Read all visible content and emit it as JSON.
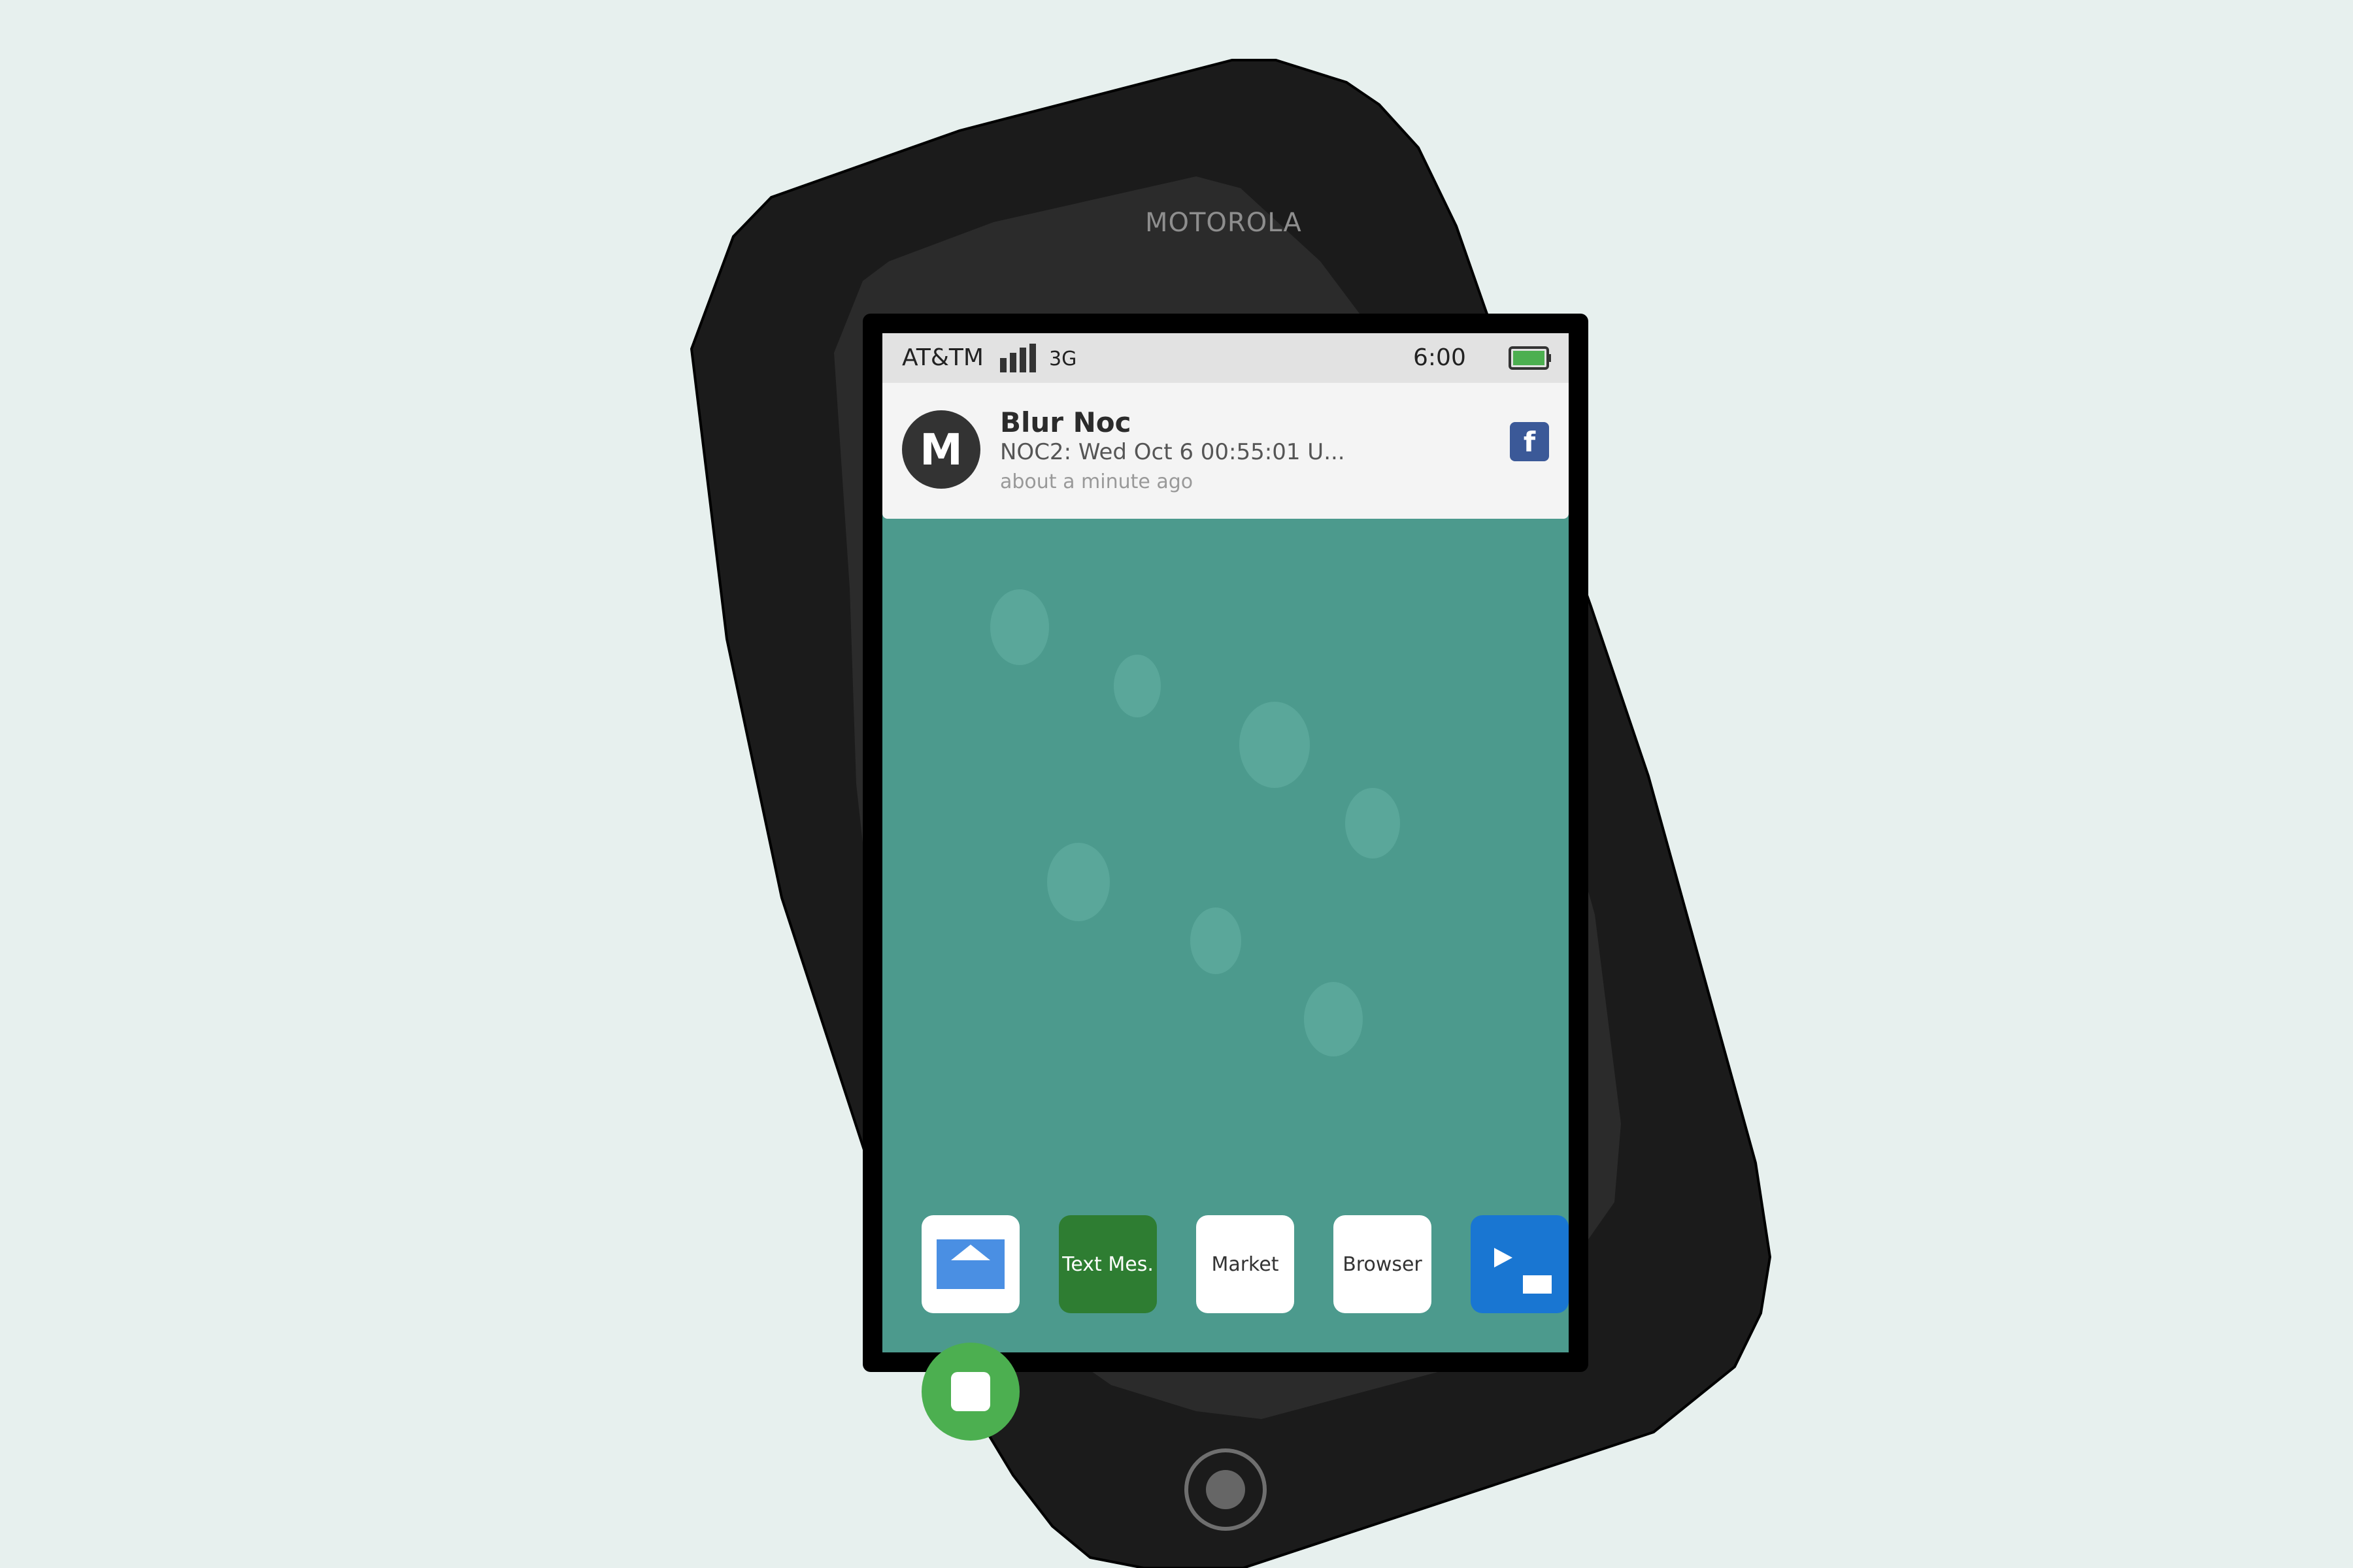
{
  "device": {
    "brand": "MOTOROLA"
  },
  "status_bar": {
    "carrier": "AT&TM",
    "network": "3G",
    "time": "6:00",
    "signal_bars": 4,
    "battery_level": 1.0,
    "icons": [
      "signal-icon",
      "battery-icon"
    ]
  },
  "notification": {
    "avatar_letter": "M",
    "title": "Blur Noc",
    "text": "NOC2: Wed Oct 6 00:55:01 U...",
    "time": "about a minute ago",
    "source_letter": "f",
    "source_icon": "facebook-icon"
  },
  "dock": {
    "email_icon": "email-icon",
    "text_label": "Text Mes.",
    "market_label": "Market",
    "browser_label": "Browser",
    "media_icon": "media-icon"
  },
  "home_button": {
    "icon": "home-icon"
  },
  "colors": {
    "background": "#e7f0ee",
    "phone_body": "#1b1b1b",
    "screen_wallpaper": "#4c9a8d",
    "facebook": "#3b5998",
    "text_app": "#2e7d32",
    "media_app": "#1976d2",
    "home_fab": "#4caf50"
  }
}
